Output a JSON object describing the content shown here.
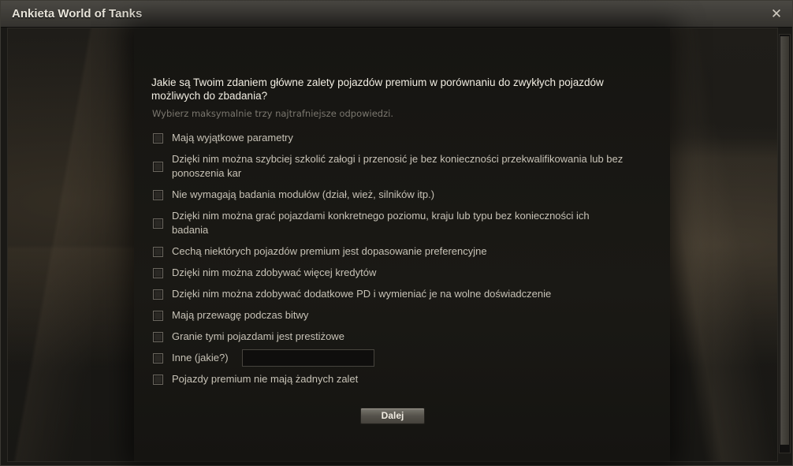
{
  "window": {
    "title": "Ankieta World of Tanks",
    "close_glyph": "✕"
  },
  "survey": {
    "question": "Jakie są Twoim zdaniem główne zalety pojazdów premium w porównaniu do zwykłych pojazdów możliwych do zbadania?",
    "hint": "Wybierz maksymalnie trzy najtrafniejsze odpowiedzi.",
    "options": [
      {
        "label": "Mają wyjątkowe parametry",
        "checked": false
      },
      {
        "label": "Dzięki nim można szybciej szkolić załogi i przenosić je bez konieczności przekwalifikowania lub bez ponoszenia kar",
        "checked": false
      },
      {
        "label": "Nie wymagają badania modułów (dział, wież, silników itp.)",
        "checked": false
      },
      {
        "label": "Dzięki nim można grać pojazdami konkretnego poziomu, kraju lub typu bez konieczności ich badania",
        "checked": false
      },
      {
        "label": "Cechą niektórych pojazdów premium jest dopasowanie preferencyjne",
        "checked": false
      },
      {
        "label": "Dzięki nim można zdobywać więcej kredytów",
        "checked": false
      },
      {
        "label": "Dzięki nim można zdobywać dodatkowe PD i wymieniać je na wolne doświadczenie",
        "checked": false
      },
      {
        "label": "Mają przewagę podczas bitwy",
        "checked": false
      },
      {
        "label": "Granie tymi pojazdami jest prestiżowe",
        "checked": false
      },
      {
        "label": "Inne (jakie?)",
        "checked": false
      },
      {
        "label": "Pojazdy premium nie mają żadnych zalet",
        "checked": false
      }
    ],
    "other_input_value": "",
    "next_label": "Dalej"
  }
}
